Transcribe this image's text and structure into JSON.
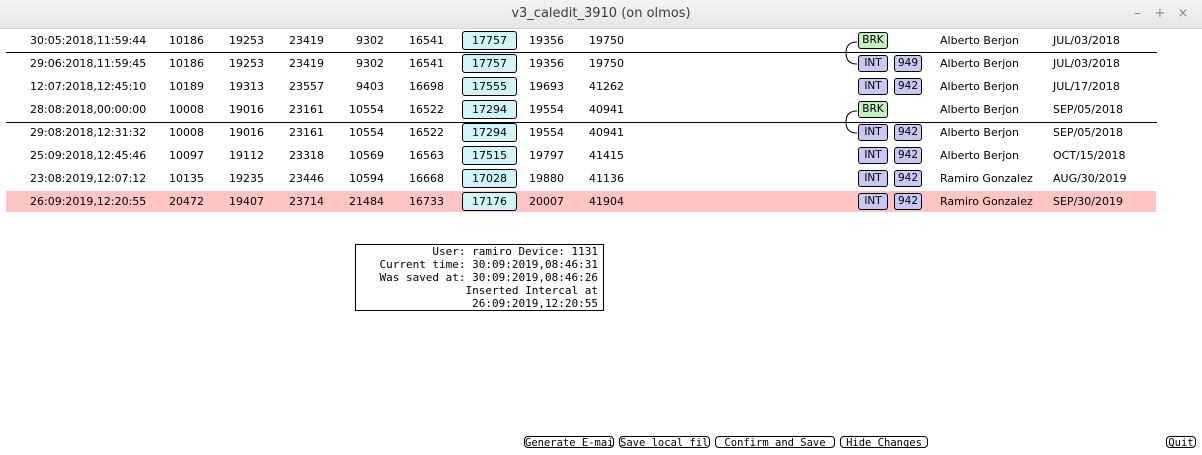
{
  "window": {
    "title": "v3_caledit_3910 (on olmos)",
    "controls": [
      "–",
      "+",
      "×"
    ]
  },
  "rows": [
    {
      "ts": "30:05:2018,11:59:44",
      "c1": "10186",
      "c2": "19253",
      "c3": "23419",
      "c4": "9302",
      "c5": "16541",
      "box": "17757",
      "c6": "19356",
      "c7": "19750",
      "tag": "BRK",
      "num": "",
      "user": "Alberto Berjon",
      "date": "JUL/03/2018"
    },
    {
      "ts": "29:06:2018,11:59:45",
      "c1": "10186",
      "c2": "19253",
      "c3": "23419",
      "c4": "9302",
      "c5": "16541",
      "box": "17757",
      "c6": "19356",
      "c7": "19750",
      "tag": "INT",
      "num": "949",
      "user": "Alberto Berjon",
      "date": "JUL/03/2018"
    },
    {
      "ts": "12:07:2018,12:45:10",
      "c1": "10189",
      "c2": "19313",
      "c3": "23557",
      "c4": "9403",
      "c5": "16698",
      "box": "17555",
      "c6": "19693",
      "c7": "41262",
      "tag": "INT",
      "num": "942",
      "user": "Alberto Berjon",
      "date": "JUL/17/2018"
    },
    {
      "ts": "28:08:2018,00:00:00",
      "c1": "10008",
      "c2": "19016",
      "c3": "23161",
      "c4": "10554",
      "c5": "16522",
      "box": "17294",
      "c6": "19554",
      "c7": "40941",
      "tag": "BRK",
      "num": "",
      "user": "Alberto Berjon",
      "date": "SEP/05/2018"
    },
    {
      "ts": "29:08:2018,12:31:32",
      "c1": "10008",
      "c2": "19016",
      "c3": "23161",
      "c4": "10554",
      "c5": "16522",
      "box": "17294",
      "c6": "19554",
      "c7": "40941",
      "tag": "INT",
      "num": "942",
      "user": "Alberto Berjon",
      "date": "SEP/05/2018"
    },
    {
      "ts": "25:09:2018,12:45:46",
      "c1": "10097",
      "c2": "19112",
      "c3": "23318",
      "c4": "10569",
      "c5": "16563",
      "box": "17515",
      "c6": "19797",
      "c7": "41415",
      "tag": "INT",
      "num": "942",
      "user": "Alberto Berjon",
      "date": "OCT/15/2018"
    },
    {
      "ts": "23:08:2019,12:07:12",
      "c1": "10135",
      "c2": "19235",
      "c3": "23446",
      "c4": "10594",
      "c5": "16668",
      "box": "17028",
      "c6": "19880",
      "c7": "41136",
      "tag": "INT",
      "num": "942",
      "user": "Ramiro Gonzalez",
      "date": "AUG/30/2019"
    },
    {
      "ts": "26:09:2019,12:20:55",
      "c1": "20472",
      "c2": "19407",
      "c3": "23714",
      "c4": "21484",
      "c5": "16733",
      "box": "17176",
      "c6": "20007",
      "c7": "41904",
      "tag": "INT",
      "num": "942",
      "user": "Ramiro Gonzalez",
      "date": "SEP/30/2019"
    }
  ],
  "info": {
    "line1": "User: ramiro Device: 1131",
    "line2": "Current time: 30:09:2019,08:46:31",
    "line3": "Was saved at: 30:09:2019,08:46:26",
    "line4": "Inserted Intercal at 26:09:2019,12:20:55"
  },
  "buttons": {
    "email": "Generate E-mail",
    "save_local": "Save local file",
    "confirm": "Confirm and Save",
    "hide": "Hide Changes",
    "quit": "Quit"
  },
  "colors": {
    "highlight_row": "#ffc4c4",
    "value_box": "#d2f4f7",
    "brk_tag": "#c5f1c0",
    "int_tag": "#c8c8f2"
  }
}
